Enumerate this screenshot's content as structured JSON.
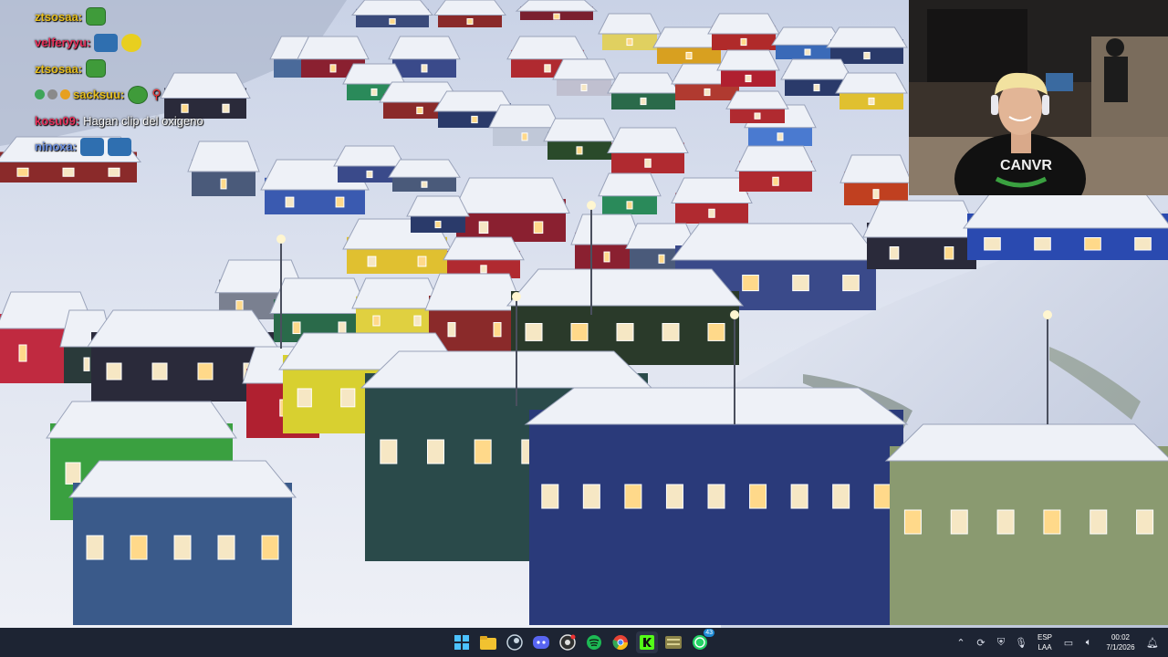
{
  "chat": {
    "messages": [
      {
        "user": "ztsosaa:",
        "user_color": "#e8c020",
        "text": "",
        "emotes": [
          "green-emote"
        ]
      },
      {
        "user": "velferyyu:",
        "user_color": "#e6305a",
        "text": "",
        "emotes": [
          "blue-emote",
          "yellow-emote"
        ]
      },
      {
        "user": "ztsosaa:",
        "user_color": "#e8c020",
        "text": "",
        "emotes": [
          "green-emote"
        ]
      },
      {
        "user": "sacksuu:",
        "user_color": "#e8c020",
        "text": "",
        "emotes": [
          "green-emote",
          "stickman-emote"
        ]
      },
      {
        "user": "kosu09:",
        "user_color": "#e6305a",
        "text": "Hagan clip del oxigeno",
        "emotes": []
      },
      {
        "user": "ninoxa:",
        "user_color": "#6a8ee0",
        "text": "",
        "emotes": [
          "blue-emote",
          "blue-emote"
        ]
      }
    ]
  },
  "webcam": {
    "shirt_text": "CANVR"
  },
  "taskbar": {
    "apps": [
      {
        "name": "windows-start-icon",
        "color": "#4cc2ff"
      },
      {
        "name": "file-explorer-icon",
        "color": "#f2c230"
      },
      {
        "name": "steam-icon",
        "color": "#c7d5e0"
      },
      {
        "name": "discord-icon",
        "color": "#5865f2"
      },
      {
        "name": "obs-icon",
        "color": "#e0e0e0"
      },
      {
        "name": "spotify-icon",
        "color": "#1db954"
      },
      {
        "name": "chrome-icon",
        "color": "#e84335"
      },
      {
        "name": "kick-icon",
        "color": "#53fc18"
      },
      {
        "name": "game-icon",
        "color": "#b8b070"
      },
      {
        "name": "whatsapp-icon",
        "color": "#25d366",
        "badge": "43"
      }
    ],
    "tray": {
      "lang_top": "ESP",
      "lang_bottom": "LAA",
      "time": "00:02",
      "date": "7/1/2026"
    }
  }
}
